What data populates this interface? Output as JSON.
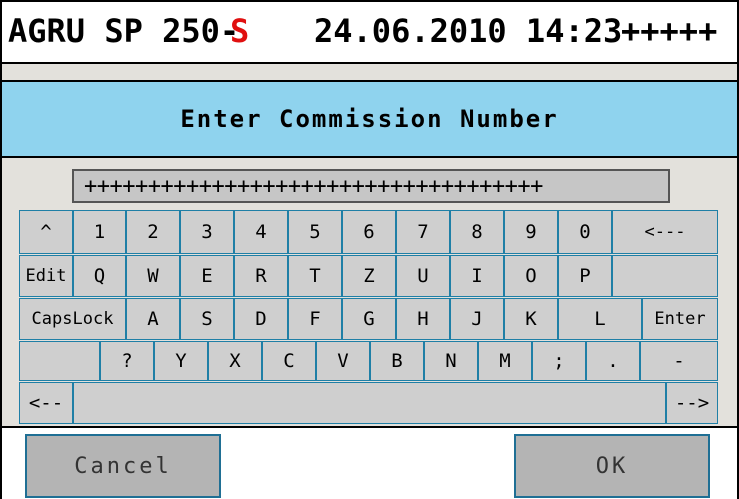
{
  "header": {
    "model": "AGRU SP 250-",
    "variant": "S",
    "datetime": "24.06.2010 14:23",
    "status": "+++++"
  },
  "title": "Enter Commission Number",
  "input": {
    "value": "++++++++++++++++++++++++++++++++++++"
  },
  "keyboard": {
    "row1": [
      "^",
      "1",
      "2",
      "3",
      "4",
      "5",
      "6",
      "7",
      "8",
      "9",
      "0",
      "<---"
    ],
    "row2": [
      "Edit",
      "Q",
      "W",
      "E",
      "R",
      "T",
      "Z",
      "U",
      "I",
      "O",
      "P",
      ""
    ],
    "row3": [
      "CapsLock",
      "A",
      "S",
      "D",
      "F",
      "G",
      "H",
      "J",
      "K",
      "L",
      "Enter"
    ],
    "row4": [
      "",
      "?",
      "Y",
      "X",
      "C",
      "V",
      "B",
      "N",
      "M",
      ";",
      ".",
      "-"
    ],
    "row5": [
      "<--",
      "",
      "-->"
    ]
  },
  "buttons": {
    "cancel": "Cancel",
    "ok": "OK"
  },
  "colors": {
    "title_bg": "#8fd3ee",
    "variant_red": "#e01010",
    "key_border": "#1f7fa6"
  }
}
